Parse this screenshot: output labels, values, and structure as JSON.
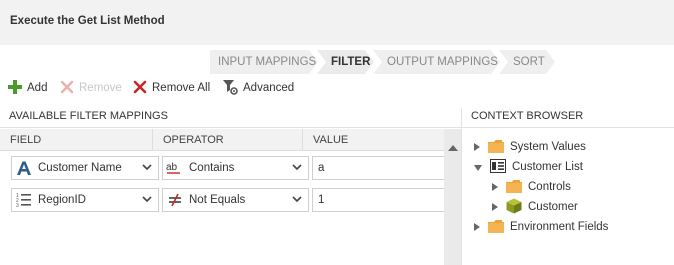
{
  "header": {
    "title": "Execute the Get List Method"
  },
  "steps": [
    {
      "label": "INPUT MAPPINGS"
    },
    {
      "label": "FILTER"
    },
    {
      "label": "OUTPUT MAPPINGS"
    },
    {
      "label": "SORT"
    }
  ],
  "active_step": "FILTER",
  "toolbar": {
    "add_label": "Add",
    "remove_label": "Remove",
    "remove_all_label": "Remove All",
    "advanced_label": "Advanced"
  },
  "filter_panel": {
    "heading": "AVAILABLE FILTER MAPPINGS",
    "columns": {
      "field": "FIELD",
      "operator": "OPERATOR",
      "value": "VALUE"
    },
    "rows": [
      {
        "field": "Customer Name",
        "field_icon": "text-type-icon",
        "operator": "Contains",
        "operator_icon": "contains-icon",
        "value": "a"
      },
      {
        "field": "RegionID",
        "field_icon": "list-type-icon",
        "operator": "Not Equals",
        "operator_icon": "not-equals-icon",
        "value": "1"
      }
    ]
  },
  "context_browser": {
    "heading": "CONTEXT BROWSER",
    "items": [
      {
        "label": "System Values",
        "icon": "folder-icon",
        "expander": "collapsed"
      },
      {
        "label": "Customer List",
        "icon": "list-view-icon",
        "expander": "expanded"
      },
      {
        "label": "Controls",
        "icon": "folder-icon",
        "expander": "collapsed"
      },
      {
        "label": "Customer",
        "icon": "smartobject-icon",
        "expander": "collapsed"
      },
      {
        "label": "Environment Fields",
        "icon": "folder-icon",
        "expander": "collapsed"
      }
    ]
  },
  "colors": {
    "add_green": "#4a9a2c",
    "remove_red": "#c62828",
    "folder_orange": "#f0a23a",
    "text_blue": "#2d5d8a"
  }
}
